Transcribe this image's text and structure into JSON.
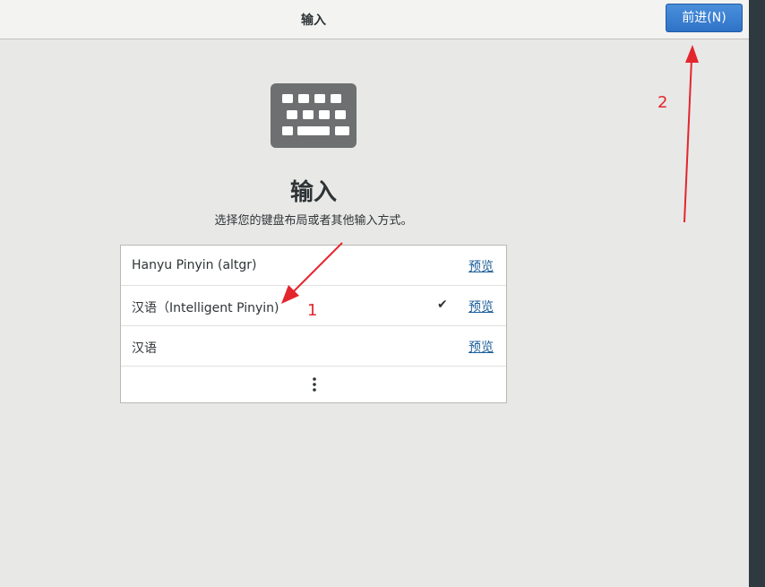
{
  "header": {
    "title": "输入",
    "next_button_label": "前进(N)"
  },
  "main": {
    "icon": "keyboard-icon",
    "title": "输入",
    "subtitle": "选择您的键盘布局或者其他输入方式。"
  },
  "layouts": [
    {
      "label": "Hanyu Pinyin (altgr)",
      "selected": false,
      "preview_label": "预览"
    },
    {
      "label": "汉语（Intelligent Pinyin)",
      "selected": true,
      "check_glyph": "✔",
      "preview_label": "预览"
    },
    {
      "label": "汉语",
      "selected": false,
      "preview_label": "预览"
    }
  ],
  "more_icon": "more-vertical-icon",
  "annotations": {
    "arrow_1_label": "1",
    "arrow_2_label": "2",
    "color": "#e3262d"
  },
  "colors": {
    "accent": "#2f73c8",
    "link": "#1b5e99",
    "background": "#e8e8e7"
  }
}
